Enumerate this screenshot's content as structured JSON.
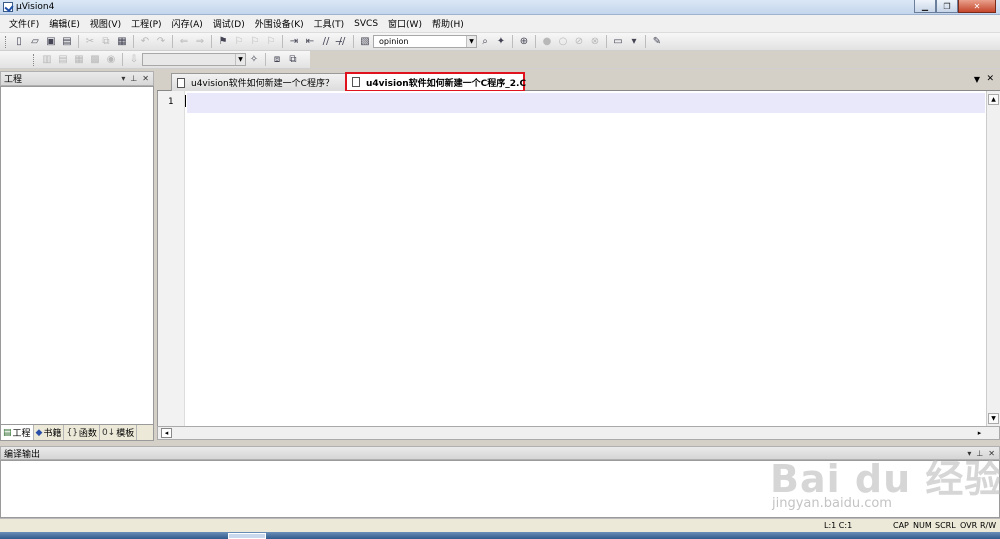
{
  "window": {
    "title": "µVision4"
  },
  "menu": [
    "文件(F)",
    "编辑(E)",
    "视图(V)",
    "工程(P)",
    "闪存(A)",
    "调试(D)",
    "外围设备(K)",
    "工具(T)",
    "SVCS",
    "窗口(W)",
    "帮助(H)"
  ],
  "toolbar": {
    "find_value": "opinion",
    "find_placeholder": ""
  },
  "project_panel": {
    "title": "工程",
    "tabs": [
      "工程",
      "书籍",
      "函数",
      "模板"
    ]
  },
  "editor": {
    "tabs": [
      "u4vision软件如何新建一个C程序？",
      "u4vision软件如何新建一个C程序_2.C"
    ],
    "active_tab": 1,
    "line_number": "1"
  },
  "output_panel": {
    "title": "编译输出"
  },
  "status": {
    "position": "L:1 C:1",
    "indicators": [
      "CAP",
      "NUM",
      "SCRL",
      "OVR",
      "R/W"
    ]
  },
  "watermark": {
    "logo": "Bai du 经验",
    "url": "jingyan.baidu.com"
  },
  "colors": {
    "highlight_border": "#e0121c",
    "current_line": "#e8e8fa"
  }
}
